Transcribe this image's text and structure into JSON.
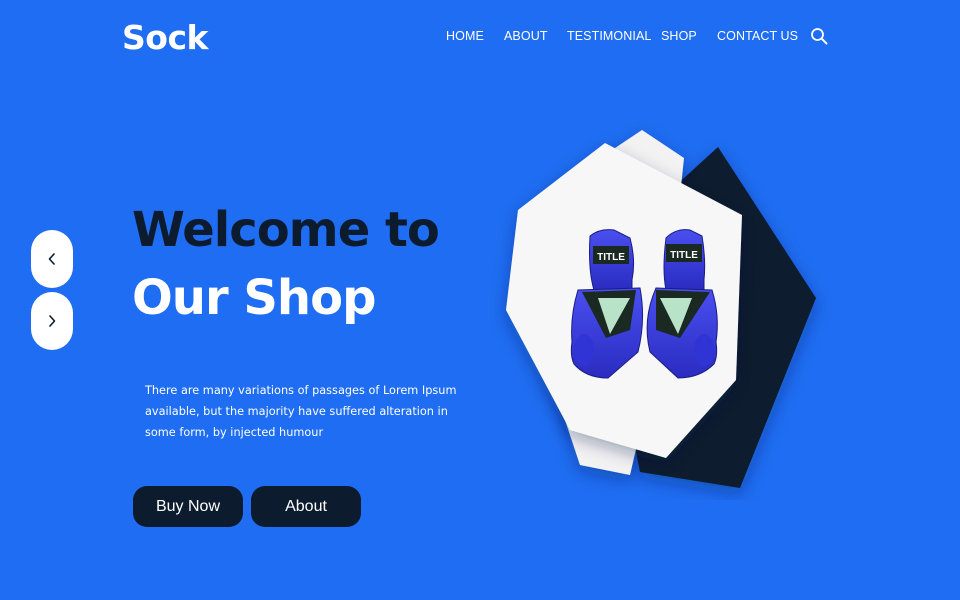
{
  "brand": {
    "logo_text": "Sock"
  },
  "nav": {
    "items": [
      {
        "label": "HOME"
      },
      {
        "label": "ABOUT"
      },
      {
        "label": "TESTIMONIAL"
      },
      {
        "label": "SHOP"
      },
      {
        "label": "CONTACT US"
      }
    ],
    "search_icon": "search-icon"
  },
  "slider": {
    "prev_icon": "chevron-left-icon",
    "next_icon": "chevron-right-icon",
    "prev_glyph": "‹",
    "next_glyph": "›"
  },
  "hero": {
    "headline_line1": "Welcome to",
    "headline_line2": "Our Shop",
    "description": "There are many variations of passages of Lorem Ipsum available, but the majority have suffered alteration in some form, by injected humour",
    "buy_now_label": "Buy Now",
    "about_label": "About",
    "product_image": "boxing-gloves-image",
    "glove_text": "TITLE"
  },
  "colors": {
    "background": "#1e6df2",
    "dark_navy": "#0d1b2e",
    "white": "#ffffff",
    "card_white": "#f5f5f6",
    "glove_blue": "#3b3fd6",
    "glove_dark": "#1a2a22",
    "glove_mint": "#b9e3c8"
  }
}
